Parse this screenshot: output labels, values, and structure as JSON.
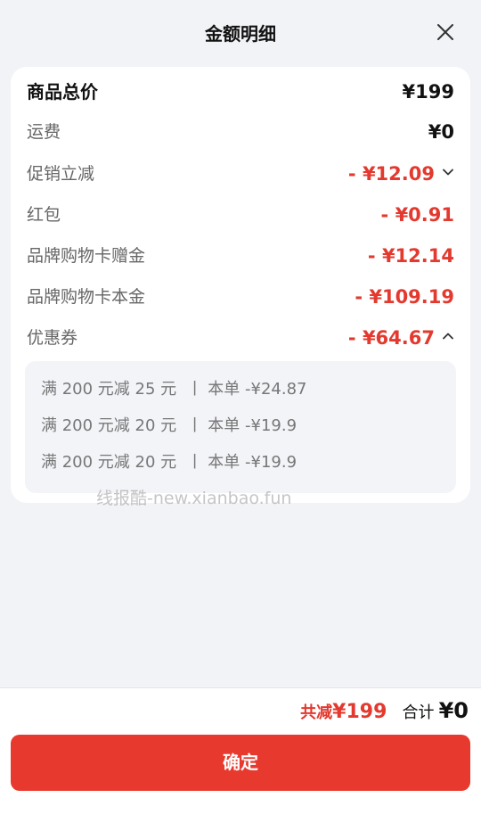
{
  "header": {
    "title": "金额明细"
  },
  "items": {
    "total": {
      "label": "商品总价",
      "value": "¥199"
    },
    "shipping": {
      "label": "运费",
      "value": "¥0"
    },
    "promotion": {
      "label": "促销立减",
      "value": "- ¥12.09"
    },
    "red_packet": {
      "label": "红包",
      "value": "- ¥0.91"
    },
    "gift_card_bonus": {
      "label": "品牌购物卡赠金",
      "value": "- ¥12.14"
    },
    "gift_card_principal": {
      "label": "品牌购物卡本金",
      "value": "- ¥109.19"
    },
    "coupon": {
      "label": "优惠券",
      "value": "- ¥64.67"
    }
  },
  "coupons": [
    {
      "text": "满 200 元减 25 元  丨 本单 -¥24.87"
    },
    {
      "text": "满 200 元减 20 元  丨 本单 -¥19.9"
    },
    {
      "text": "满 200 元减 20 元  丨 本单 -¥19.9"
    }
  ],
  "watermark": "线报酷-new.xianbao.fun",
  "footer": {
    "reduce_label": "共减",
    "reduce_value": "¥199",
    "total_label": "合计",
    "total_value": "¥0",
    "confirm_label": "确定"
  },
  "colors": {
    "accent": "#e8392e",
    "discount_text": "#e3392e",
    "background": "#f2f3f7"
  },
  "icons": {
    "close": "close-icon",
    "promotion_expand": "chevron-down-icon",
    "coupon_collapse": "chevron-up-icon"
  }
}
